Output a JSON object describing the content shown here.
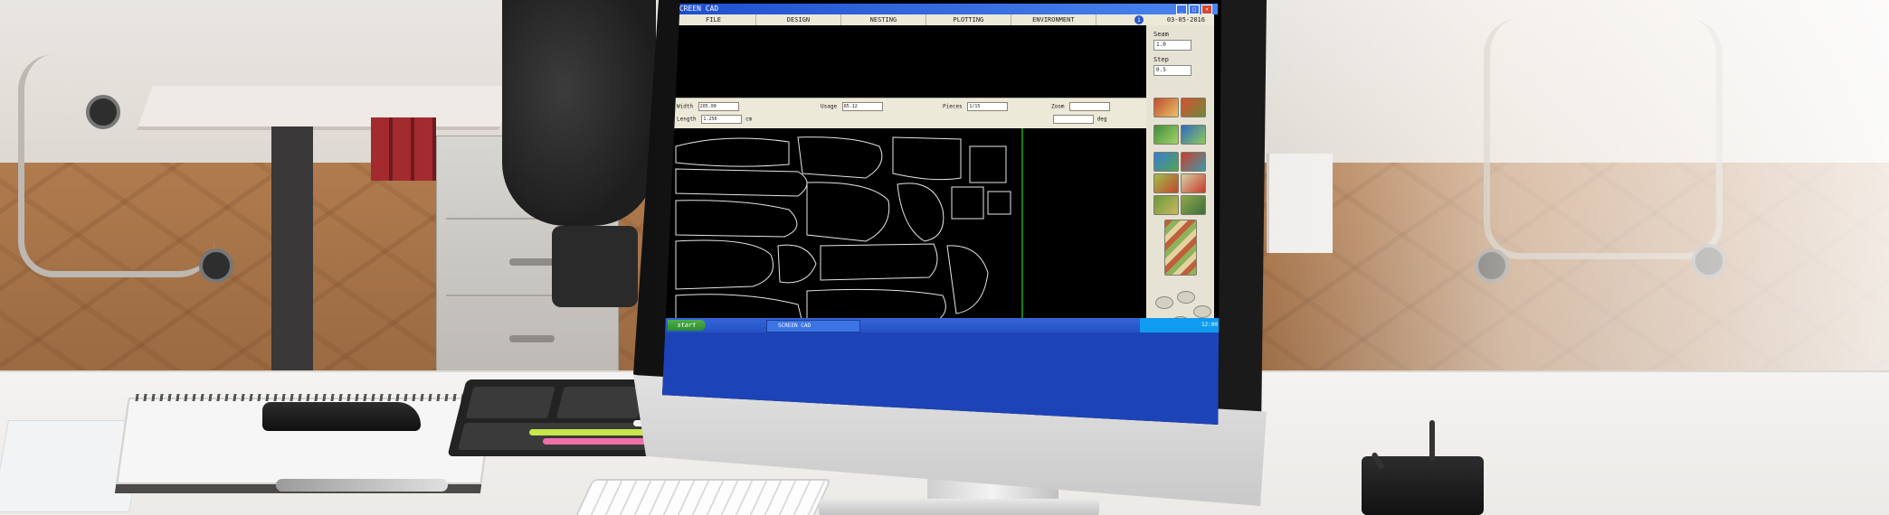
{
  "monitor": {
    "window_title": "SCREEN CAD",
    "menu": [
      "FILE",
      "DESIGN",
      "NESTING",
      "PLOTTING",
      "ENVIRONMENT"
    ],
    "date": "03-05-2016",
    "info_icon": "info-icon",
    "params": {
      "label_a": "Width",
      "value_a": "205.00",
      "label_b": "Length",
      "value_b": "1.250",
      "label_c": "Usage",
      "value_c": "85.12",
      "label_d": "Pieces",
      "value_d": "1/15",
      "label_e": "Zoom",
      "unit_a": "cm",
      "unit_b": "deg"
    },
    "side": {
      "field_1_label": "Seam",
      "field_1_value": "1.0",
      "field_2_label": "Step",
      "field_2_value": "0.5"
    },
    "taskbar": {
      "start_label": "start",
      "task_label": "SCREEN CAD",
      "clock": "12:00"
    }
  },
  "colors": {
    "canvas": "#000000",
    "pattern_line": "#e6e6e6",
    "marker_line": "#1fd12f",
    "xp_blue": "#1d43b8",
    "panel_bg": "#ece9d8"
  },
  "icons": [
    "info-icon",
    "close-icon",
    "maximize-icon",
    "minimize-icon",
    "scissors-icon",
    "pattern-tool-icon"
  ]
}
